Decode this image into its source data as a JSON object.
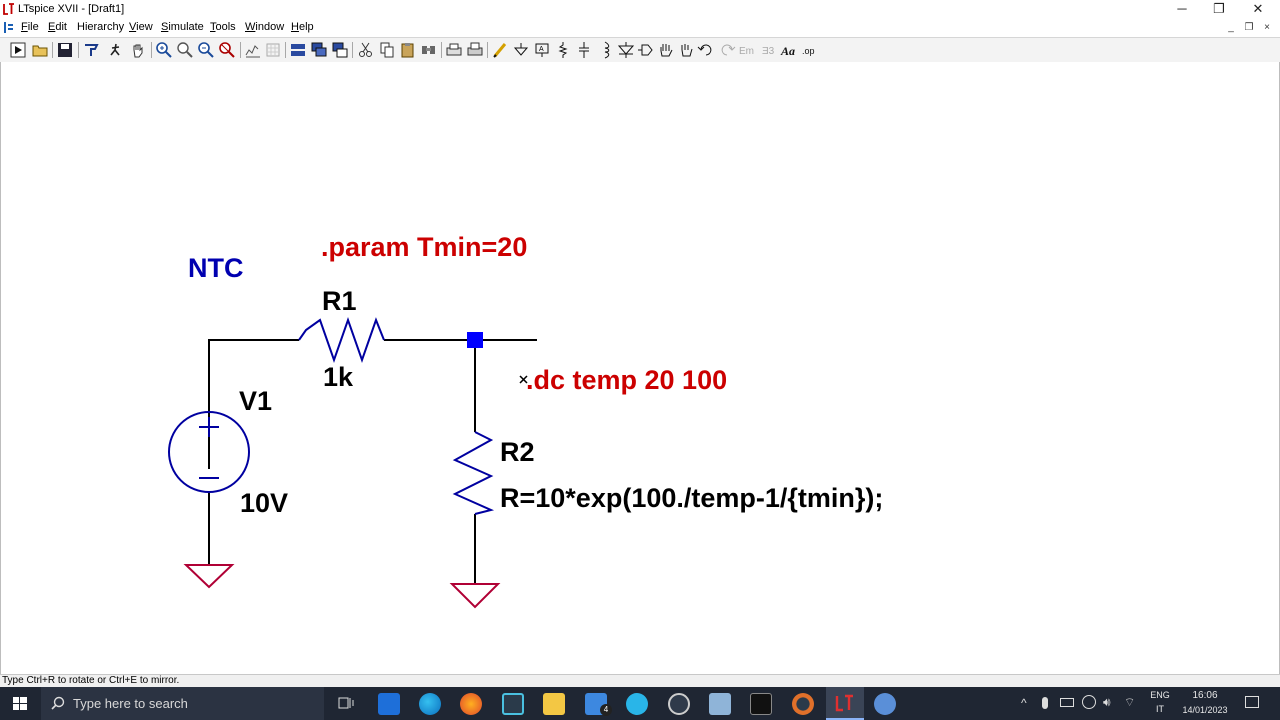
{
  "window": {
    "title": "LTspice XVII - [Draft1]",
    "buttons": {
      "minimize": "─",
      "restore": "❐",
      "close": "✕"
    }
  },
  "menu": {
    "items": [
      {
        "key": "F",
        "rest": "ile"
      },
      {
        "key": "E",
        "rest": "dit"
      },
      {
        "key": "",
        "rest": "Hierarchy"
      },
      {
        "key": "V",
        "rest": "iew"
      },
      {
        "key": "S",
        "rest": "imulate"
      },
      {
        "key": "T",
        "rest": "ools"
      },
      {
        "key": "W",
        "rest": "indow"
      },
      {
        "key": "H",
        "rest": "elp"
      }
    ],
    "mdi": {
      "minimize": "_",
      "restore": "❐",
      "close": "×"
    }
  },
  "schematic": {
    "colors": {
      "wire": "#000000",
      "component": "#0000a0",
      "junction": "#0000ff",
      "ground": "#b00035",
      "directive": "#cc0000",
      "label": "#0000b0",
      "text": "#000000"
    },
    "net_label": "NTC",
    "directive_param": ".param Tmin=20",
    "directive_dc": ".dc temp 20 100",
    "r1": {
      "name": "R1",
      "value": "1k"
    },
    "v1": {
      "name": "V1",
      "value": "10V"
    },
    "r2": {
      "name": "R2",
      "value": "R=10*exp(100./temp-1/{tmin});"
    }
  },
  "status": {
    "text": "Type Ctrl+R to rotate or Ctrl+E to mirror."
  },
  "taskbar": {
    "search_placeholder": "Type here to search",
    "mail_badge": "4",
    "lang_top": "ENG",
    "lang_bottom": "IT",
    "time": "16:06",
    "date": "14/01/2023"
  }
}
